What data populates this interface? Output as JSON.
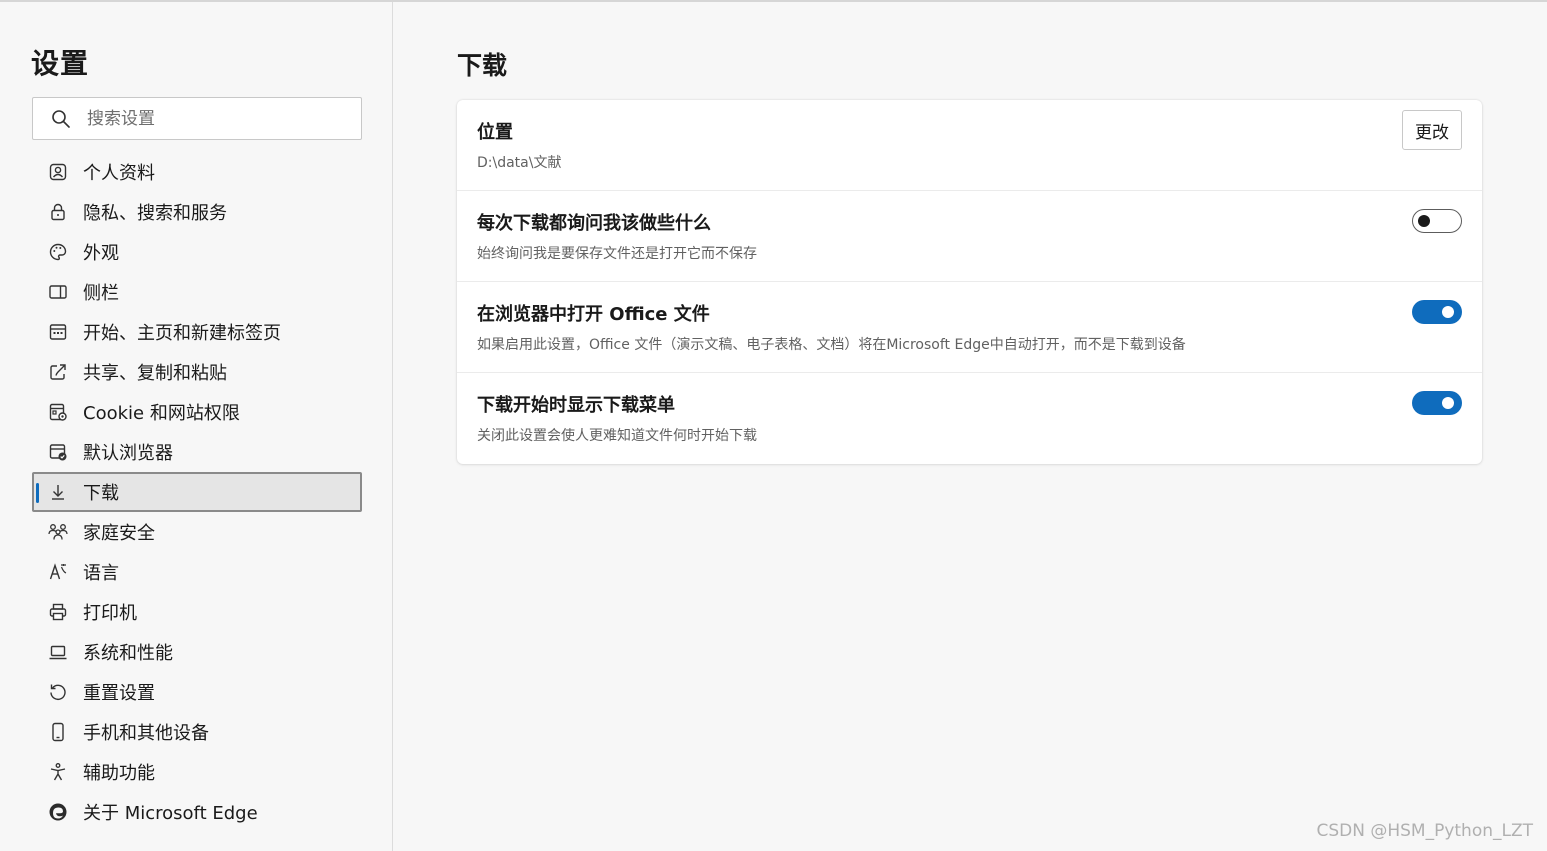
{
  "sidebar": {
    "title": "设置",
    "search": {
      "placeholder": "搜索设置"
    },
    "items": [
      {
        "label": "个人资料",
        "icon": "profile-icon"
      },
      {
        "label": "隐私、搜索和服务",
        "icon": "lock-icon"
      },
      {
        "label": "外观",
        "icon": "palette-icon"
      },
      {
        "label": "侧栏",
        "icon": "sidebar-icon"
      },
      {
        "label": "开始、主页和新建标签页",
        "icon": "home-tab-icon"
      },
      {
        "label": "共享、复制和粘贴",
        "icon": "share-icon"
      },
      {
        "label": "Cookie 和网站权限",
        "icon": "cookie-permissions-icon"
      },
      {
        "label": "默认浏览器",
        "icon": "default-browser-icon"
      },
      {
        "label": "下载",
        "icon": "download-icon",
        "active": true
      },
      {
        "label": "家庭安全",
        "icon": "family-icon"
      },
      {
        "label": "语言",
        "icon": "language-icon"
      },
      {
        "label": "打印机",
        "icon": "printer-icon"
      },
      {
        "label": "系统和性能",
        "icon": "laptop-icon"
      },
      {
        "label": "重置设置",
        "icon": "reset-icon"
      },
      {
        "label": "手机和其他设备",
        "icon": "phone-icon"
      },
      {
        "label": "辅助功能",
        "icon": "accessibility-icon"
      },
      {
        "label": "关于 Microsoft Edge",
        "icon": "edge-logo-icon"
      }
    ]
  },
  "main": {
    "title": "下载",
    "location": {
      "title": "位置",
      "path": "D:\\data\\文献",
      "button": "更改"
    },
    "ask": {
      "title": "每次下载都询问我该做些什么",
      "desc": "始终询问我是要保存文件还是打开它而不保存",
      "enabled": false
    },
    "office": {
      "title": "在浏览器中打开 Office 文件",
      "desc": "如果启用此设置，Office 文件（演示文稿、电子表格、文档）将在Microsoft Edge中自动打开，而不是下载到设备",
      "enabled": true
    },
    "menu": {
      "title": "下载开始时显示下载菜单",
      "desc": "关闭此设置会使人更难知道文件何时开始下载",
      "enabled": true
    }
  },
  "watermark": "CSDN @HSM_Python_LZT",
  "colors": {
    "accent": "#0f6cbd",
    "background": "#f7f7f7"
  }
}
